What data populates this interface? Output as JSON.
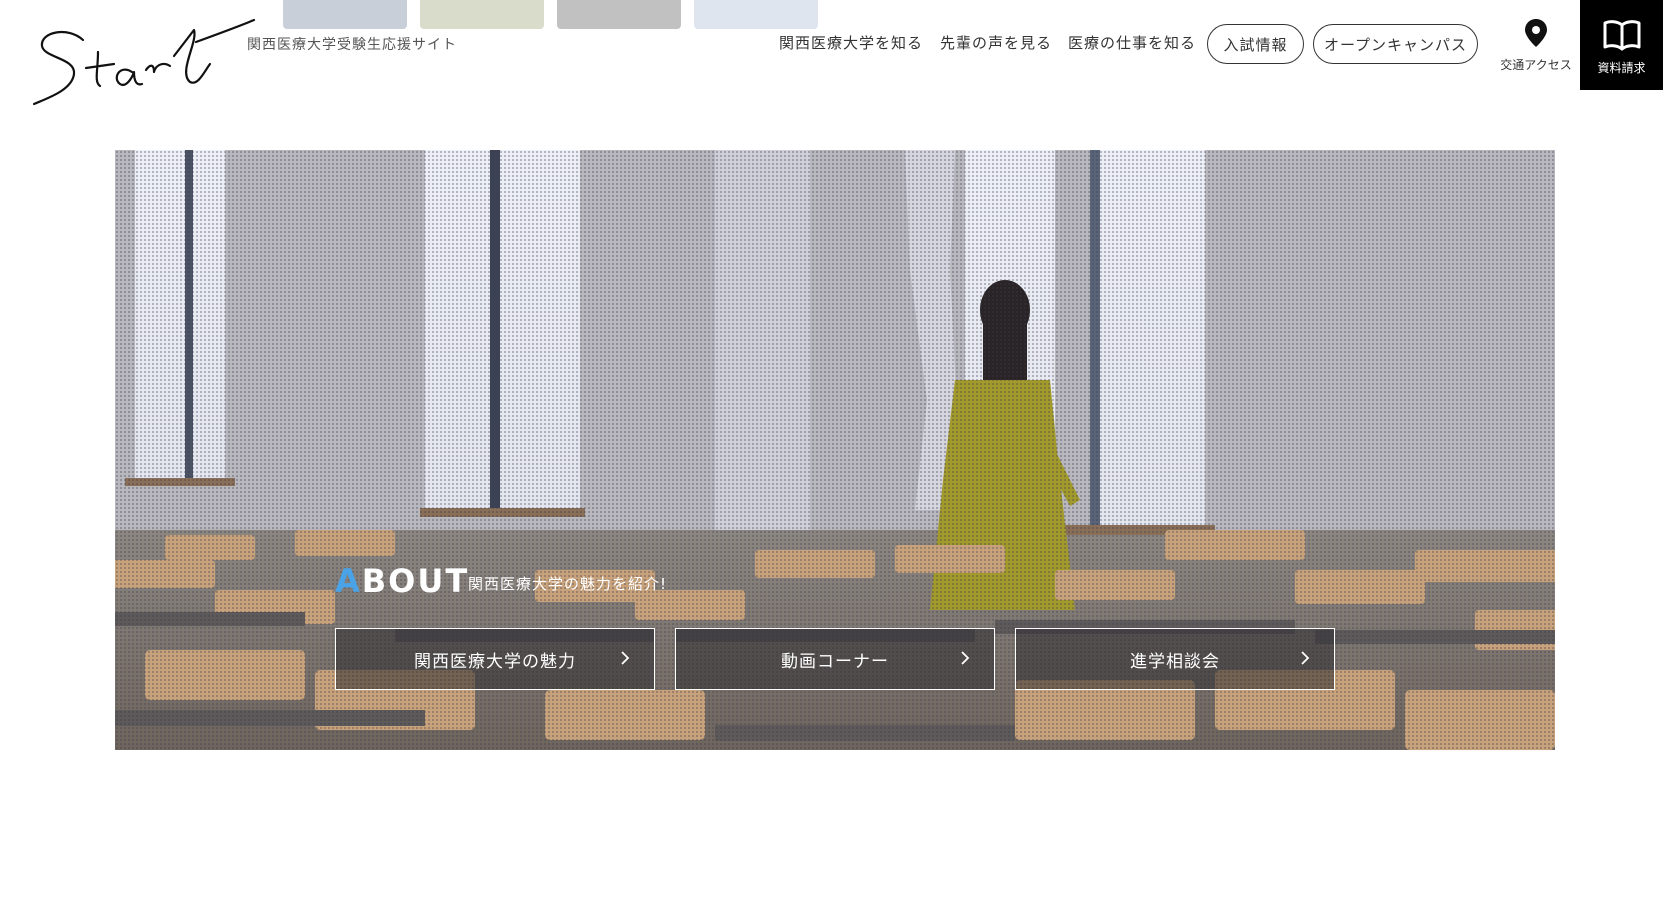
{
  "header": {
    "logo_text": "Start",
    "tagline": "関西医療大学受験生応援サイト",
    "nav": [
      {
        "label": "関西医療大学を知る"
      },
      {
        "label": "先輩の声を見る"
      },
      {
        "label": "医療の仕事を知る"
      }
    ],
    "pills": [
      {
        "label": "入試情報"
      },
      {
        "label": "オープンキャンパス"
      }
    ],
    "access_label": "交通アクセス",
    "brochure_label": "資料請求"
  },
  "hero": {
    "about_initial": "A",
    "about_rest": "BOUT",
    "about_sub": "関西医療大学の魅力を紹介!",
    "buttons": [
      {
        "label": "関西医療大学の魅力"
      },
      {
        "label": "動画コーナー"
      },
      {
        "label": "進学相談会"
      }
    ]
  },
  "colors": {
    "accent": "#4aa3e6",
    "dress": "#a39a2c",
    "brochure_bg": "#000000"
  }
}
